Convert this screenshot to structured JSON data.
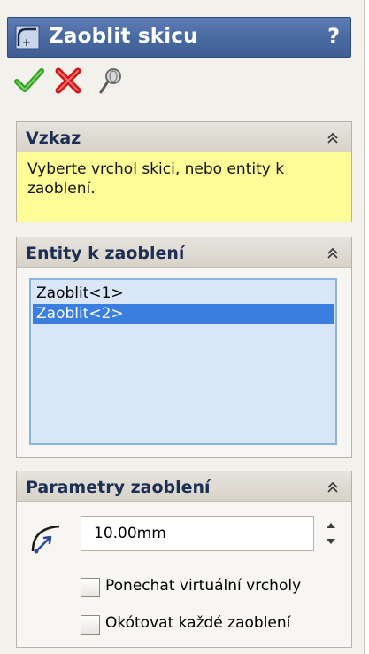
{
  "title": "Zaoblit skicu",
  "help_label": "?",
  "icons": {
    "title": "sketch-fillet-icon",
    "ok": "green-check-icon",
    "cancel": "red-x-icon",
    "pushpin": "pushpin-icon",
    "collapse": "double-chevron-up-icon",
    "radius": "fillet-radius-icon"
  },
  "colors": {
    "titlebar": "#4a6aa2",
    "ok": "#2e9e1f",
    "cancel": "#d01818",
    "message_bg": "#fefc96",
    "selection": "#3a7fe0"
  },
  "message_group": {
    "title": "Vzkaz",
    "text": "Vyberte vrchol skici, nebo entity k zaoblení."
  },
  "entities_group": {
    "title": "Entity k zaoblení",
    "items": [
      {
        "label": "Zaoblit<1>",
        "selected": false
      },
      {
        "label": "Zaoblit<2>",
        "selected": true
      }
    ]
  },
  "parameters_group": {
    "title": "Parametry zaoblení",
    "radius_value": "10.00mm",
    "keep_virtual_vertices": {
      "label": "Ponechat virtuální vrcholy",
      "checked": false
    },
    "dimension_each_fillet": {
      "label": "Okótovat každé zaoblení",
      "checked": false
    }
  }
}
